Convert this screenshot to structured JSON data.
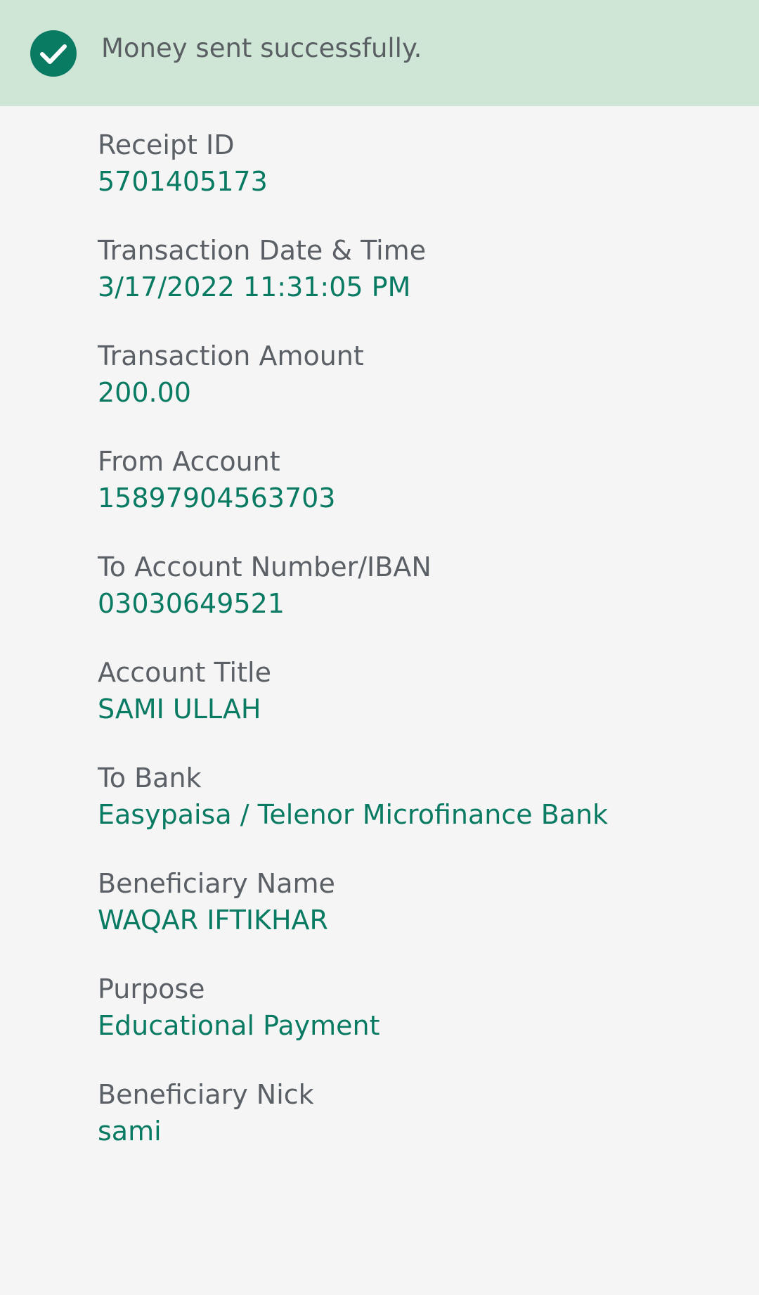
{
  "banner": {
    "message": "Money sent successfully.",
    "icon": "check-circle-icon",
    "icon_color": "#0a7b63",
    "background": "#cfe5d6"
  },
  "colors": {
    "label": "#5b6066",
    "value": "#0a7b63",
    "page_background": "#f5f5f5"
  },
  "details": [
    {
      "label": "Receipt ID",
      "value": "5701405173"
    },
    {
      "label": "Transaction Date & Time",
      "value": "3/17/2022 11:31:05 PM"
    },
    {
      "label": "Transaction Amount",
      "value": "200.00"
    },
    {
      "label": "From Account",
      "value": "15897904563703"
    },
    {
      "label": "To Account Number/IBAN",
      "value": "03030649521"
    },
    {
      "label": "Account Title",
      "value": "SAMI ULLAH"
    },
    {
      "label": "To Bank",
      "value": "Easypaisa / Telenor Microfinance Bank"
    },
    {
      "label": "Beneficiary Name",
      "value": "WAQAR IFTIKHAR"
    },
    {
      "label": "Purpose",
      "value": "Educational Payment"
    },
    {
      "label": "Beneficiary Nick",
      "value": "sami"
    }
  ]
}
